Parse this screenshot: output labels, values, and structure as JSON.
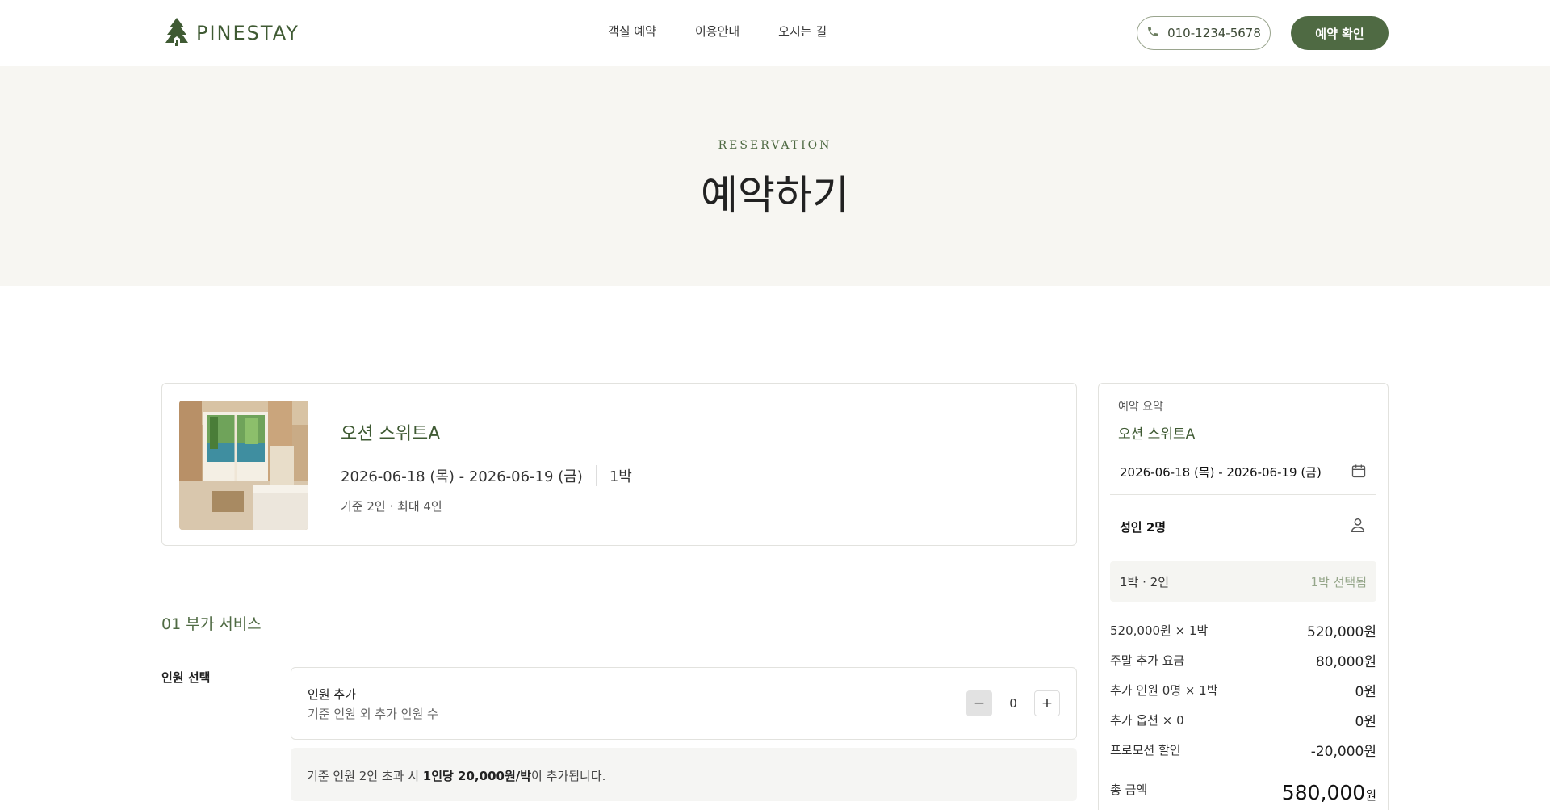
{
  "brand": {
    "name": "PINESTAY",
    "accent": "#4f6a43"
  },
  "nav": {
    "items": [
      "객실 예약",
      "이용안내",
      "오시는 길"
    ]
  },
  "header": {
    "phone": "010-1234-5678",
    "confirm_label": "예약 확인"
  },
  "hero": {
    "eyebrow": "RESERVATION",
    "title": "예약하기"
  },
  "room": {
    "name": "오션 스위트A",
    "dates": "2026-06-18 (목) - 2026-06-19 (금)",
    "nights": "1박",
    "capacity": "기준 2인 · 최대 4인"
  },
  "addons": {
    "section_title": "01 부가 서비스",
    "field_label": "인원 선택",
    "extra_guest_title": "인원 추가",
    "extra_guest_desc": "기준 인원 외 추가 인원 수",
    "minus_label": "−",
    "plus_label": "+",
    "quantity": "0",
    "note_prefix": "기준 인원 2인 초과 시 ",
    "note_bold": "1인당 20,000원/박",
    "note_suffix": "이 추가됩니다."
  },
  "summary": {
    "label": "예약 요약",
    "room": "오션 스위트A",
    "dates": "2026-06-18 (목) - 2026-06-19 (금)",
    "guests": "성인 2명",
    "chip_left": "1박 · 2인",
    "chip_right": "1박 선택됨",
    "lines": [
      {
        "k": "520,000원 × 1박",
        "v": "520,000원"
      },
      {
        "k": "주말 추가 요금",
        "v": "80,000원"
      },
      {
        "k": "추가 인원 0명 × 1박",
        "v": "0원"
      },
      {
        "k": "추가 옵션 × 0",
        "v": "0원"
      },
      {
        "k": "프로모션 할인",
        "v": "-20,000원"
      }
    ],
    "total_label": "총 금액",
    "total_value": "580,000",
    "total_unit": "원"
  }
}
